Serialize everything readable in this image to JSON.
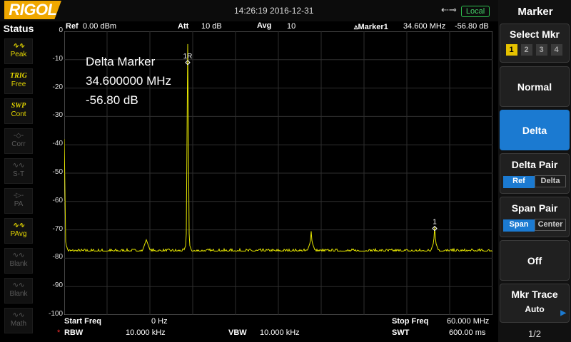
{
  "topbar": {
    "logo": "RIGOL",
    "datetime": "14:26:19 2016-12-31",
    "usb_icon": "usb-icon",
    "remote_status": "Local"
  },
  "status_panel": {
    "title": "Status",
    "items": [
      {
        "line1": "∿∿",
        "line2": "Peak",
        "state": "on"
      },
      {
        "line1": "TRIG",
        "line2": "Free",
        "state": "on"
      },
      {
        "line1": "SWP",
        "line2": "Cont",
        "state": "on"
      },
      {
        "line1": "-◇-",
        "line2": "Corr",
        "state": "off"
      },
      {
        "line1": "∿∿",
        "line2": "S-T",
        "state": "off"
      },
      {
        "line1": "-▷-",
        "line2": "PA",
        "state": "off"
      },
      {
        "line1": "∿∿",
        "line2": "PAvg",
        "state": "on"
      },
      {
        "line1": "∿∿",
        "line2": "Blank",
        "state": "off"
      },
      {
        "line1": "∿∿",
        "line2": "Blank",
        "state": "off"
      },
      {
        "line1": "∿∿",
        "line2": "Math",
        "state": "off"
      }
    ]
  },
  "header_info": {
    "ref_label": "Ref",
    "ref_value": "0.00 dBm",
    "att_label": "Att",
    "att_value": "10 dB",
    "avg_label": "Avg",
    "avg_value": "10",
    "marker_label": "▵Marker1",
    "marker_freq": "34.600 MHz",
    "marker_level": "-56.80 dB"
  },
  "y_axis": {
    "ticks": [
      "0",
      "-10",
      "-20",
      "-30",
      "-40",
      "-50",
      "-60",
      "-70",
      "-80",
      "-90",
      "-100"
    ]
  },
  "delta_readout": {
    "title": "Delta Marker",
    "frequency": "34.600000 MHz",
    "level": "-56.80 dB"
  },
  "markers": {
    "ref_label": "1R",
    "delta_label": "1"
  },
  "bottom_info": {
    "start_label": "Start Freq",
    "start_value": "0 Hz",
    "stop_label": "Stop Freq",
    "stop_value": "60.000 MHz",
    "rbw_label": "RBW",
    "rbw_value": "10.000 kHz",
    "vbw_label": "VBW",
    "vbw_value": "10.000 kHz",
    "swt_label": "SWT",
    "swt_value": "600.00 ms",
    "rbw_flag": "*"
  },
  "menu": {
    "title": "Marker",
    "select_mkr_label": "Select Mkr",
    "mkr_numbers": [
      "1",
      "2",
      "3",
      "4"
    ],
    "selected_mkr": "1",
    "normal_label": "Normal",
    "delta_label": "Delta",
    "delta_pair_label": "Delta Pair",
    "delta_pair_options": [
      "Ref",
      "Delta"
    ],
    "span_pair_label": "Span Pair",
    "span_pair_options": [
      "Span",
      "Center"
    ],
    "off_label": "Off",
    "mkr_trace_label": "Mkr Trace",
    "mkr_trace_value": "Auto",
    "page_indicator": "1/2",
    "accent_color": "#1b7ad1"
  },
  "chart_data": {
    "type": "line",
    "x_unit": "MHz",
    "y_unit": "dBm",
    "xlim": [
      0,
      60
    ],
    "ylim": [
      -100,
      0
    ],
    "grid": true,
    "series": [
      {
        "color": "#e6e600",
        "noise_floor": -77.5,
        "peaks": [
          {
            "x": 0.0,
            "y": -38
          },
          {
            "x": 11.5,
            "y": -75
          },
          {
            "x": 17.3,
            "y": -4.5
          },
          {
            "x": 34.6,
            "y": -70.5
          },
          {
            "x": 51.9,
            "y": -69
          }
        ]
      }
    ],
    "marker_points": [
      {
        "label": "1R",
        "x": 17.3,
        "y": -11
      },
      {
        "label": "1",
        "x": 51.9,
        "y": -69.5
      }
    ]
  }
}
